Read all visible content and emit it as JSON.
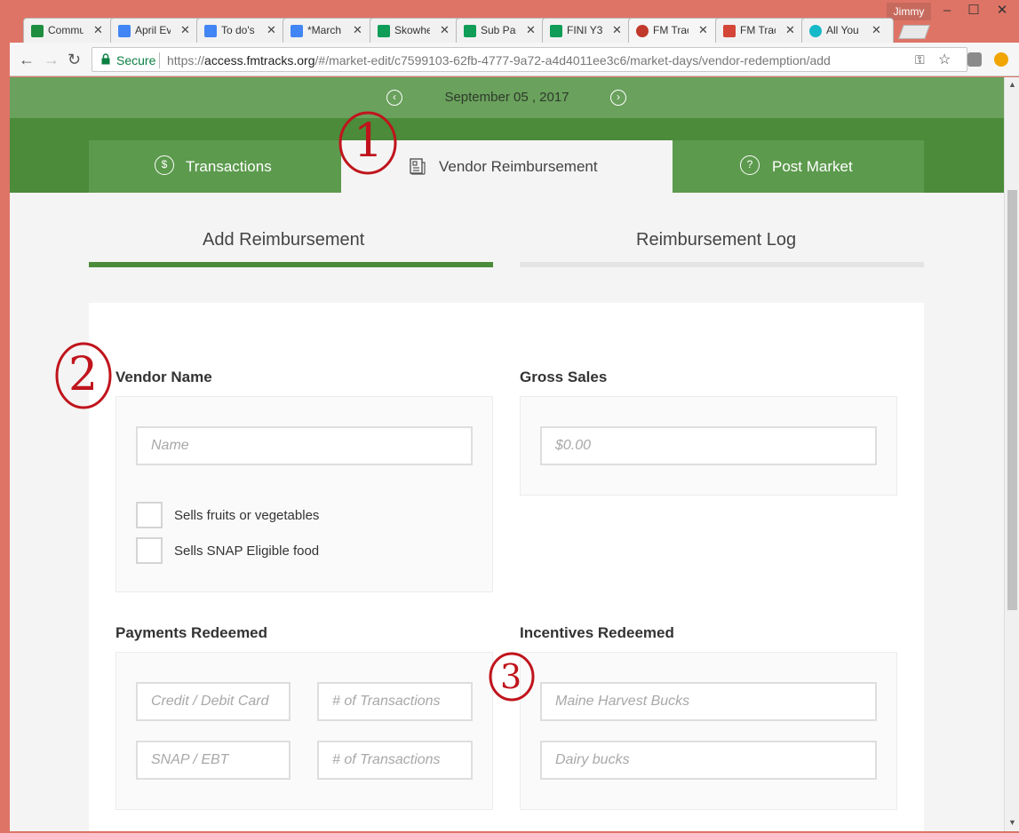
{
  "window": {
    "user": "Jimmy",
    "minimize": "–",
    "maximize": "☐",
    "close": "✕"
  },
  "browser_tabs": [
    {
      "title": "Community",
      "favicon_color": "#1e8e3e"
    },
    {
      "title": "April Events",
      "favicon_color": "#4285f4"
    },
    {
      "title": "To do's",
      "favicon_color": "#4285f4"
    },
    {
      "title": "*March",
      "favicon_color": "#4285f4"
    },
    {
      "title": "Skowhegan",
      "favicon_color": "#0f9d58"
    },
    {
      "title": "Sub Pages",
      "favicon_color": "#0f9d58"
    },
    {
      "title": "FINI Y3",
      "favicon_color": "#0f9d58"
    },
    {
      "title": "FM Tracks",
      "favicon_color": "#c0392b"
    },
    {
      "title": "FM Tracks",
      "favicon_color": "#d44638"
    },
    {
      "title": "All You",
      "favicon_color": "#16b9c8"
    }
  ],
  "tab_close": "✕",
  "toolbar": {
    "back": "←",
    "forward": "→",
    "reload": "↻",
    "secure_label": "Secure",
    "url_scheme": "https://",
    "url_host": "access.fmtracks.org",
    "url_path": "/#/market-edit/c7599103-62fb-4777-9a72-a4d4011ee3c6/market-days/vendor-redemption/add",
    "key_icon": "⚿",
    "star_icon": "☆"
  },
  "date_bar": {
    "date": "September 05 , 2017",
    "prev": "‹",
    "next": "›"
  },
  "main_tabs": [
    {
      "label": "Transactions",
      "icon": "$"
    },
    {
      "label": "Vendor Reimbursement",
      "icon": "doc"
    },
    {
      "label": "Post Market",
      "icon": "?"
    }
  ],
  "sub_tabs": {
    "add": "Add Reimbursement",
    "log": "Reimbursement Log"
  },
  "form": {
    "vendor_name_label": "Vendor Name",
    "vendor_name_placeholder": "Name",
    "checkbox_fruits": "Sells fruits or vegetables",
    "checkbox_snap": "Sells SNAP Eligible food",
    "gross_sales_label": "Gross Sales",
    "gross_sales_placeholder": "$0.00",
    "payments_label": "Payments Redeemed",
    "credit_placeholder": "Credit / Debit Card",
    "credit_tx_placeholder": "# of Transactions",
    "snap_placeholder": "SNAP / EBT",
    "snap_tx_placeholder": "# of Transactions",
    "incentives_label": "Incentives Redeemed",
    "maine_placeholder": "Maine Harvest Bucks",
    "dairy_placeholder": "Dairy bucks"
  },
  "annotations": {
    "one": "1",
    "two": "2",
    "three": "3"
  },
  "colors": {
    "green_dark": "#4b8b39",
    "green_tab": "#5c9a4d",
    "green_date": "#6aa15d",
    "annotation_red": "#c0141c"
  }
}
